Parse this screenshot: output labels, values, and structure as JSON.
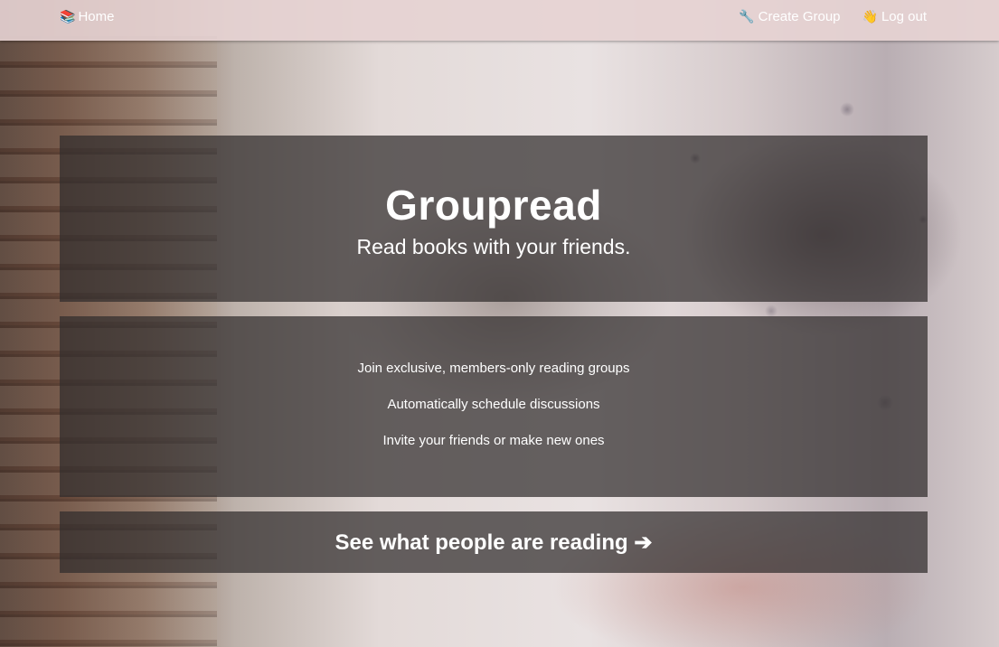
{
  "nav": {
    "home": {
      "icon": "books-icon",
      "glyph": "📚",
      "label": "Home"
    },
    "create_group": {
      "icon": "wrench-icon",
      "glyph": "🔧",
      "label": "Create Group"
    },
    "logout": {
      "icon": "wave-icon",
      "glyph": "👋",
      "label": "Log out"
    }
  },
  "hero": {
    "title": "Groupread",
    "subtitle": "Read books with your friends."
  },
  "features": [
    "Join exclusive, members-only reading groups",
    "Automatically schedule discussions",
    "Invite your friends or make new ones"
  ],
  "cta": {
    "label": "See what people are reading",
    "arrow": "➔"
  }
}
